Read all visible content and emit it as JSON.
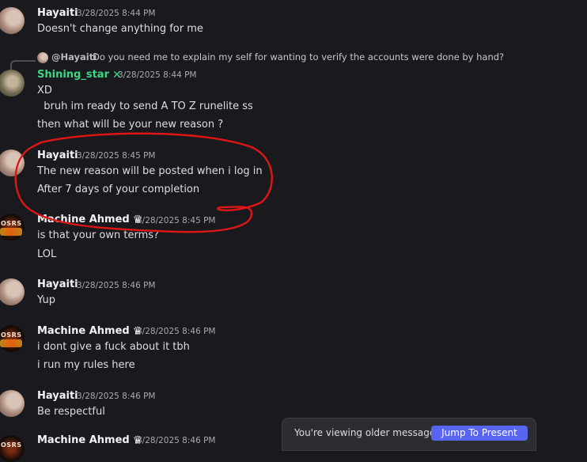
{
  "messages": [
    {
      "author": "Hayaiti",
      "timestamp": "3/28/2025 8:44 PM",
      "lines": [
        "Doesn't change anything for me"
      ]
    },
    {
      "reply": {
        "author": "@Hayaiti",
        "text": "Do you need me to explain my self for wanting to verify the accounts were done by hand?"
      },
      "author": "Shining_star",
      "badge": "✕",
      "timestamp": "3/28/2025 8:44 PM",
      "lines": [
        "XD",
        "  bruh im ready to send A TO Z runelite ss",
        "then what will be your new reason ?"
      ]
    },
    {
      "author": "Hayaiti",
      "timestamp": "3/28/2025 8:45 PM",
      "lines": [
        "The new reason will be posted when i log in",
        "After 7 days of your completion"
      ]
    },
    {
      "author": "Machine Ahmed",
      "badge": "♛",
      "timestamp": "3/28/2025 8:45 PM",
      "avatar_text": "OSRS",
      "lines": [
        "is that your own terms?",
        "LOL"
      ]
    },
    {
      "author": "Hayaiti",
      "timestamp": "3/28/2025 8:46 PM",
      "lines": [
        "Yup"
      ]
    },
    {
      "author": "Machine Ahmed",
      "badge": "♛",
      "timestamp": "3/28/2025 8:46 PM",
      "avatar_text": "OSRS",
      "lines": [
        "i dont give a fuck about it tbh",
        "i run my rules here"
      ]
    },
    {
      "author": "Hayaiti",
      "timestamp": "3/28/2025 8:46 PM",
      "lines": [
        "Be respectful"
      ]
    },
    {
      "author": "Machine Ahmed",
      "badge": "♛",
      "timestamp": "3/28/2025 8:46 PM",
      "avatar_text": "OSRS",
      "lines": []
    }
  ],
  "banner": {
    "text": "You're viewing older messages",
    "button": "Jump To Present"
  },
  "colors": {
    "background": "#1a1a1e",
    "accent": "#5865f2",
    "annotation": "#e01515",
    "green_name": "#3ed684"
  }
}
